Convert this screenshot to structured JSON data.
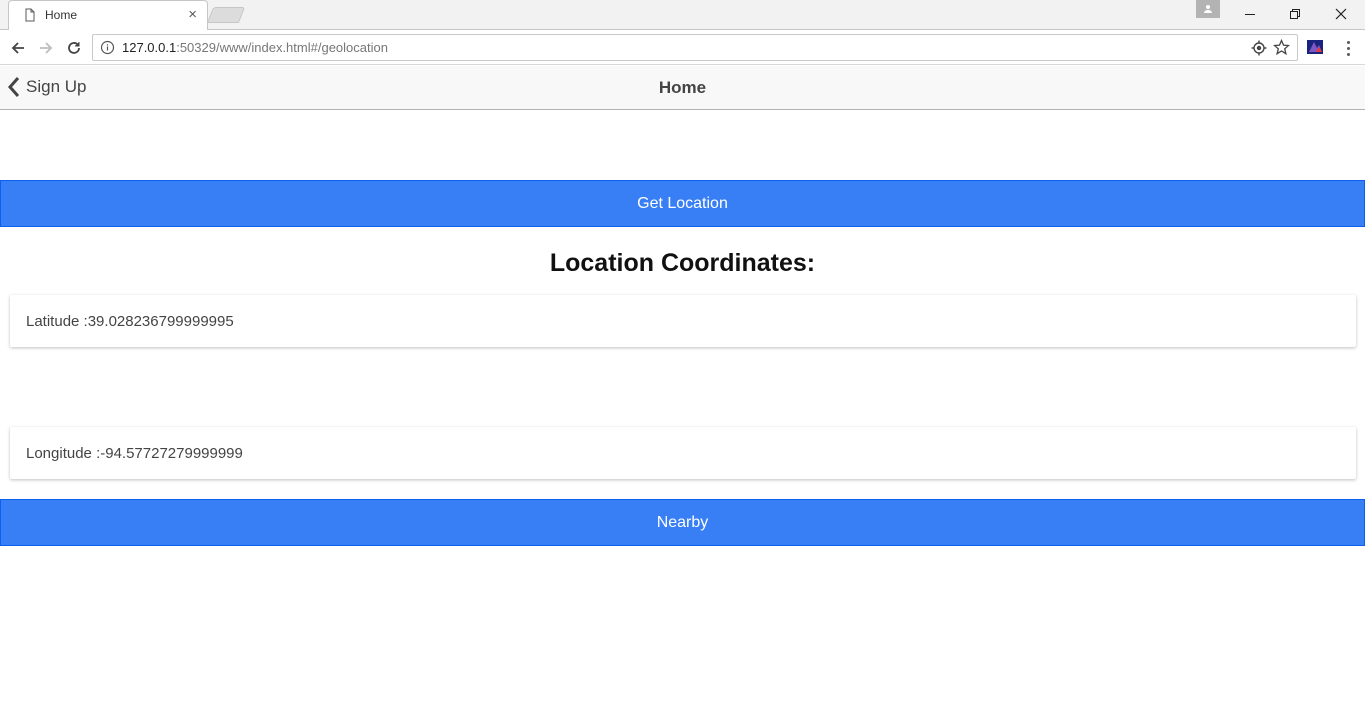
{
  "browser": {
    "tab_title": "Home",
    "tab_close": "×",
    "url_host": "127.0.0.1",
    "url_rest": ":50329/www/index.html#/geolocation"
  },
  "icons": {
    "favicon": "page-icon",
    "back": "arrow-left-icon",
    "forward": "arrow-right-icon",
    "reload": "reload-icon",
    "info": "info-icon",
    "location": "location-icon",
    "bookmark": "star-icon",
    "extension": "extension-icon",
    "menu": "kebab-menu-icon",
    "profile": "profile-icon"
  },
  "app": {
    "back_label": "Sign Up",
    "title": "Home",
    "get_location_label": "Get Location",
    "coords_heading": "Location Coordinates:",
    "latitude_text": "Latitude :39.028236799999995",
    "longitude_text": "Longitude :-94.57727279999999",
    "nearby_label": "Nearby"
  },
  "colors": {
    "primary_button": "#387ef5",
    "appbar_bg": "#f8f8f8"
  }
}
